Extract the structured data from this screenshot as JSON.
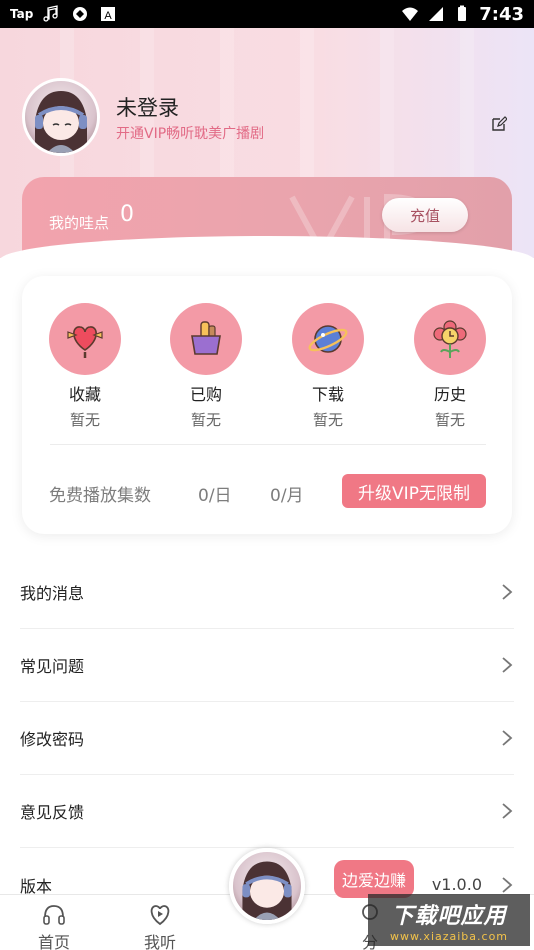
{
  "status_bar": {
    "left_text": "Tap",
    "time": "7:43"
  },
  "profile": {
    "name": "未登录",
    "subtitle": "开通VIP畅听耽美广播剧",
    "edit_icon": "edit-icon"
  },
  "wallet": {
    "label": "我的哇点",
    "value": "0",
    "button": "充值"
  },
  "features": [
    {
      "label": "收藏",
      "sub": "暂无",
      "icon": "lollipop-heart-icon"
    },
    {
      "label": "已购",
      "sub": "暂无",
      "icon": "shopping-basket-icon"
    },
    {
      "label": "下载",
      "sub": "暂无",
      "icon": "planet-icon"
    },
    {
      "label": "历史",
      "sub": "暂无",
      "icon": "flower-clock-icon"
    }
  ],
  "free_play": {
    "label": "免费播放集数",
    "daily": "0/日",
    "monthly": "0/月",
    "upgrade": "升级VIP无限制"
  },
  "menu": [
    {
      "label": "我的消息"
    },
    {
      "label": "常见问题"
    },
    {
      "label": "修改密码"
    },
    {
      "label": "意见反馈"
    },
    {
      "label": "版本",
      "value": "v1.0.0"
    }
  ],
  "bottom_nav": {
    "home": "首页",
    "listen": "我听",
    "share": "分"
  },
  "promo": "边爱边赚",
  "watermark": {
    "main": "下载吧应用",
    "url": "www.xiazaiba.com"
  },
  "colors": {
    "accent": "#f07885",
    "feature_circle": "#f39aa6"
  }
}
